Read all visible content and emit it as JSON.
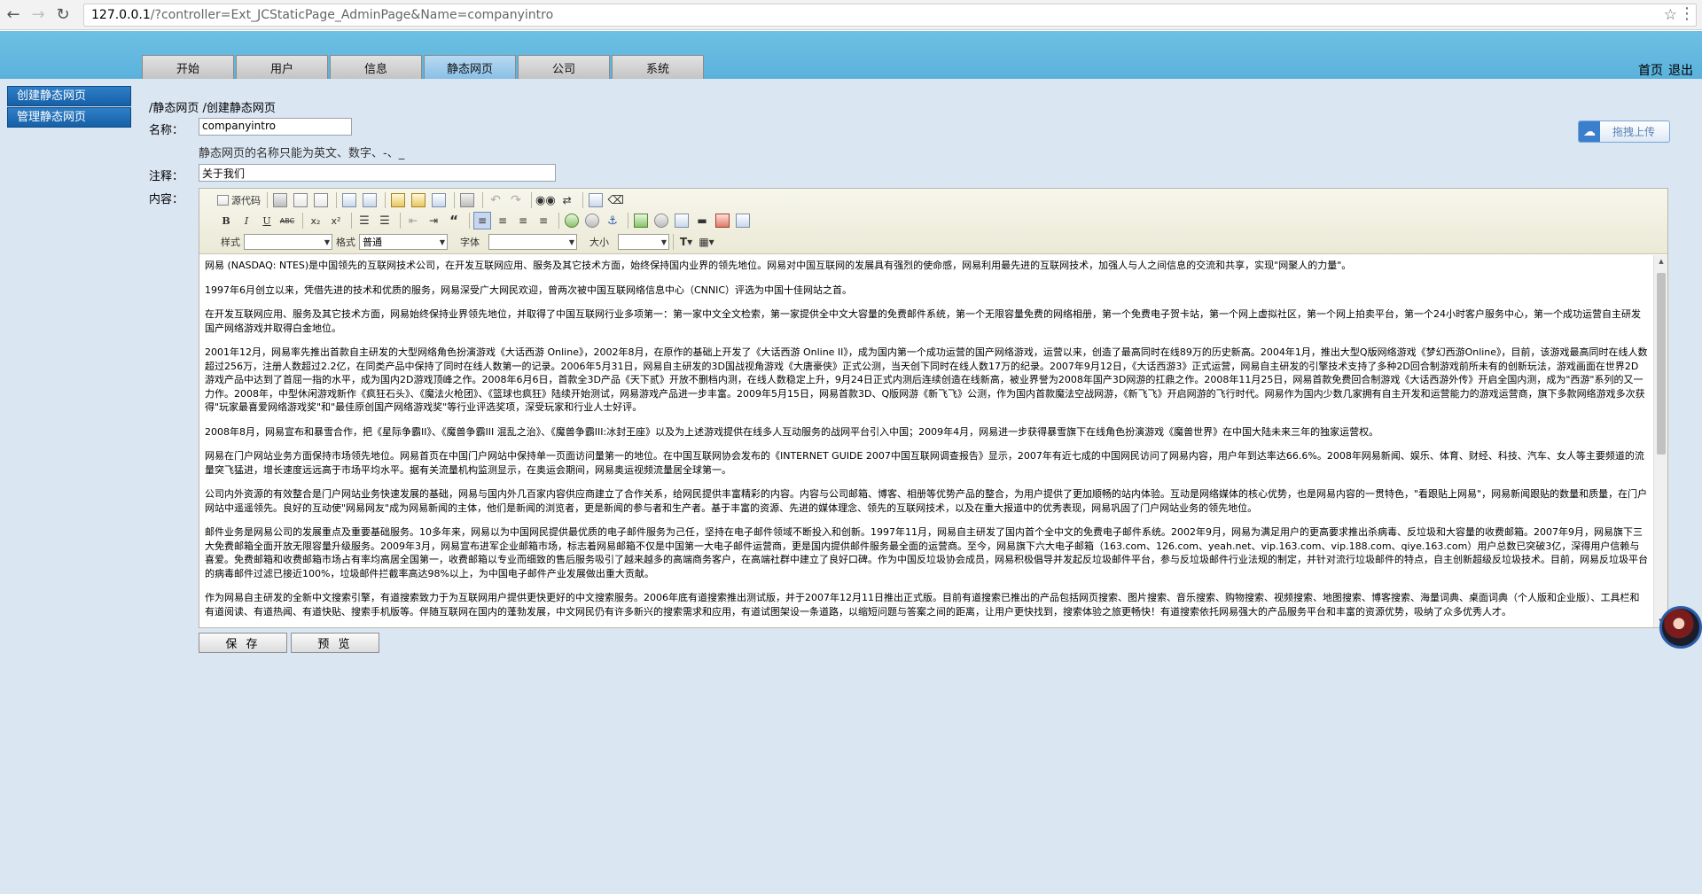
{
  "browser": {
    "url_host": "127.0.0.1",
    "url_path": "/?controller=Ext_JCStaticPage_AdminPage&Name=companyintro"
  },
  "header": {
    "tabs": [
      {
        "label": "开始"
      },
      {
        "label": "用户"
      },
      {
        "label": "信息"
      },
      {
        "label": "静态网页"
      },
      {
        "label": "公司"
      },
      {
        "label": "系统"
      }
    ],
    "home_link": "首页",
    "logout_link": "退出"
  },
  "sidebar": {
    "items": [
      {
        "label": "创建静态网页"
      },
      {
        "label": "管理静态网页"
      }
    ]
  },
  "breadcrumb": "/静态网页 /创建静态网页",
  "form": {
    "name_label": "名称：",
    "name_value": "companyintro",
    "name_hint": "静态网页的名称只能为英文、数字、-、_",
    "note_label": "注释：",
    "note_value": "关于我们",
    "content_label": "内容："
  },
  "upload": {
    "label": "拖拽上传",
    "icon": "cloud-upload-icon"
  },
  "toolbar": {
    "source_label": "源代码",
    "style_label": "样式",
    "style_value": "",
    "format_label": "格式",
    "format_value": "普通",
    "font_label": "字体",
    "font_value": "",
    "size_label": "大小",
    "size_value": "",
    "bold": "B",
    "italic": "I",
    "underline": "U",
    "strike": "ABC",
    "subscript": "x₂",
    "superscript": "x²"
  },
  "editor": {
    "paragraphs": [
      "网易 (NASDAQ: NTES)是中国领先的互联网技术公司，在开发互联网应用、服务及其它技术方面，始终保持国内业界的领先地位。网易对中国互联网的发展具有强烈的使命感，网易利用最先进的互联网技术，加强人与人之间信息的交流和共享，实现\"网聚人的力量\"。",
      "1997年6月创立以来，凭借先进的技术和优质的服务，网易深受广大网民欢迎，曾两次被中国互联网络信息中心（CNNIC）评选为中国十佳网站之首。",
      "在开发互联网应用、服务及其它技术方面，网易始终保持业界领先地位，并取得了中国互联网行业多项第一：第一家中文全文检索，第一家提供全中文大容量的免费邮件系统，第一个无限容量免费的网络相册，第一个免费电子贺卡站，第一个网上虚拟社区，第一个网上拍卖平台，第一个24小时客户服务中心，第一个成功运营自主研发国产网络游戏并取得白金地位。",
      "2001年12月，网易率先推出首款自主研发的大型网络角色扮演游戏《大话西游 Online》，2002年8月，在原作的基础上开发了《大话西游 Online II》，成为国内第一个成功运营的国产网络游戏，运营以来，创造了最高同时在线89万的历史新高。2004年1月，推出大型Q版网络游戏《梦幻西游Online》，目前，该游戏最高同时在线人数超过256万，注册人数超过2.2亿，在同类产品中保持了同时在线人数第一的记录。2006年5月31日，网易自主研发的3D国战视角游戏《大唐豪侠》正式公测，当天创下同时在线人数17万的纪录。2007年9月12日，《大话西游3》正式运营，网易自主研发的引擎技术支持了多种2D回合制游戏前所未有的创新玩法，游戏画面在世界2D游戏产品中达到了首屈一指的水平，成为国内2D游戏顶峰之作。2008年6月6日，首款全3D产品《天下贰》开放不删档内测，在线人数稳定上升，9月24日正式内测后连续创造在线新高，被业界誉为2008年国产3D网游的扛鼎之作。2008年11月25日，网易首款免费回合制游戏《大话西游外传》开启全国内测，成为\"西游\"系列的又一力作。2008年，中型休闲游戏新作《疯狂石头》、《魔法火枪团》、《篮球也疯狂》陆续开始测试，网易游戏产品进一步丰富。2009年5月15日，网易首款3D、Q版网游《新飞飞》公测，作为国内首款魔法空战网游，《新飞飞》开启网游的飞行时代。网易作为国内少数几家拥有自主开发和运营能力的游戏运营商，旗下多款网络游戏多次获得\"玩家最喜爱网络游戏奖\"和\"最佳原创国产网络游戏奖\"等行业评选奖项，深受玩家和行业人士好评。",
      "2008年8月，网易宣布和暴雪合作，把《星际争霸II》、《魔兽争霸III 混乱之治》、《魔兽争霸III:冰封王座》以及为上述游戏提供在线多人互动服务的战网平台引入中国；2009年4月，网易进一步获得暴雪旗下在线角色扮演游戏《魔兽世界》在中国大陆未来三年的独家运营权。",
      "网易在门户网站业务方面保持市场领先地位。网易首页在中国门户网站中保持单一页面访问量第一的地位。在中国互联网协会发布的《INTERNET GUIDE 2007中国互联网调查报告》显示，2007年有近七成的中国网民访问了网易内容，用户年到达率达66.6%。2008年网易新闻、娱乐、体育、财经、科技、汽车、女人等主要频道的流量突飞猛进，增长速度远远高于市场平均水平。据有关流量机构监测显示，在奥运会期间，网易奥运视频流量居全球第一。",
      "公司内外资源的有效整合是门户网站业务快速发展的基础，网易与国内外几百家内容供应商建立了合作关系，给网民提供丰富精彩的内容。内容与公司邮箱、博客、相册等优势产品的整合，为用户提供了更加顺畅的站内体验。互动是网络媒体的核心优势，也是网易内容的一贯特色，\"看跟贴上网易\"，网易新闻跟贴的数量和质量，在门户网站中遥遥领先。良好的互动使\"网易网友\"成为网易新闻的主体，他们是新闻的浏览者，更是新闻的参与者和生产者。基于丰富的资源、先进的媒体理念、领先的互联网技术，以及在重大报道中的优秀表现，网易巩固了门户网站业务的领先地位。",
      "邮件业务是网易公司的发展重点及重要基础服务。10多年来，网易以为中国网民提供最优质的电子邮件服务为己任，坚持在电子邮件领域不断投入和创新。1997年11月，网易自主研发了国内首个全中文的免费电子邮件系统。2002年9月，网易为满足用户的更高要求推出杀病毒、反垃圾和大容量的收费邮箱。2007年9月，网易旗下三大免费邮箱全面开放无限容量升级服务。2009年3月，网易宣布进军企业邮箱市场，标志着网易邮箱不仅是中国第一大电子邮件运营商，更是国内提供邮件服务最全面的运营商。至今，网易旗下六大电子邮箱（163.com、126.com、yeah.net、vip.163.com、vip.188.com、qiye.163.com）用户总数已突破3亿，深得用户信赖与喜爱。免费邮箱和收费邮箱市场占有率均高居全国第一，收费邮箱以专业而细致的售后服务吸引了越来越多的高端商务客户，在高端社群中建立了良好口碑。作为中国反垃圾协会成员，网易积极倡导并发起反垃圾邮件平台，参与反垃圾邮件行业法规的制定，并针对流行垃圾邮件的特点，自主创新超级反垃圾技术。目前，网易反垃圾平台的病毒邮件过滤已接近100%，垃圾邮件拦截率高达98%以上，为中国电子邮件产业发展做出重大贡献。",
      "作为网易自主研发的全新中文搜索引擎，有道搜索致力于为互联网用户提供更快更好的中文搜索服务。2006年底有道搜索推出测试版，并于2007年12月11日推出正式版。目前有道搜索已推出的产品包括网页搜索、图片搜索、音乐搜索、购物搜索、视频搜索、地图搜索、博客搜索、海量词典、桌面词典（个人版和企业版）、工具栏和有道阅读、有道热闻、有道快贴、搜索手机版等。伴随互联网在国内的蓬勃发展，中文网民仍有许多新兴的搜索需求和应用，有道试图架设一条道路，以缩短问题与答案之间的距离，让用户更快找到，搜索体验之旅更畅快！有道搜索依托网易强大的产品服务平台和丰富的资源优势，吸纳了众多优秀人才。"
    ]
  },
  "buttons": {
    "save": "保 存",
    "preview": "预 览"
  }
}
